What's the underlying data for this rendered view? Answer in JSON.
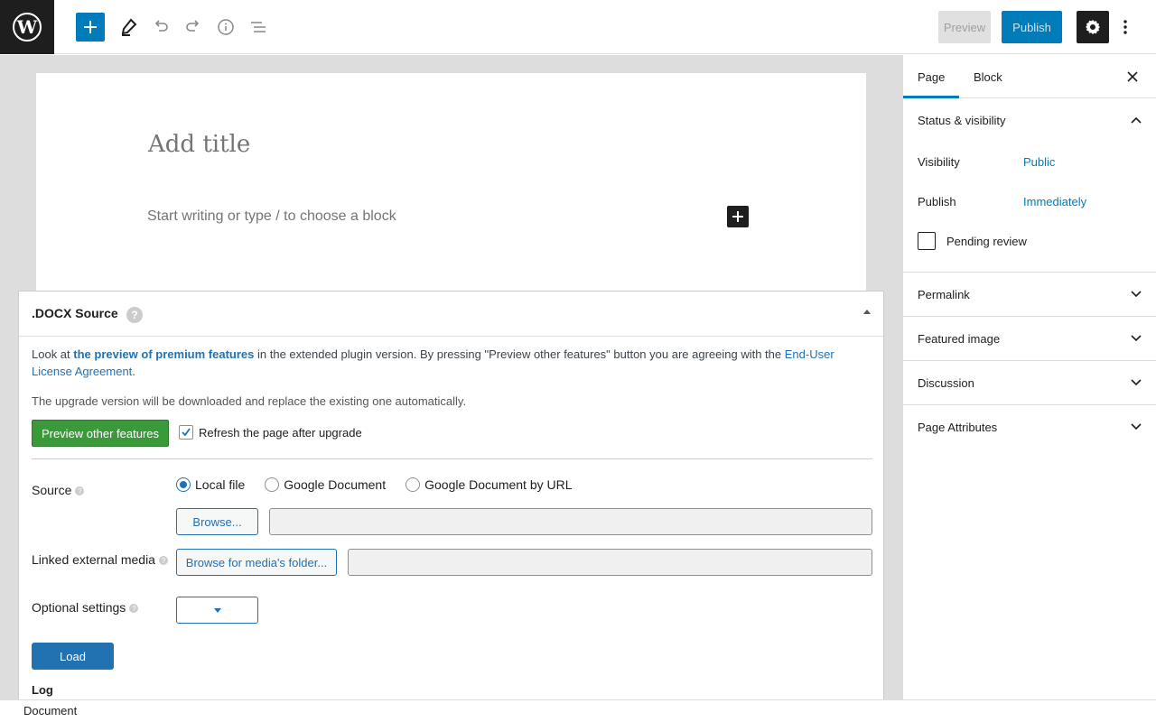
{
  "toolbar": {
    "logo_icon": "wordpress-logo",
    "add_icon": "plus-icon",
    "tools_icon": "pencil-icon",
    "undo_icon": "undo-icon",
    "redo_icon": "redo-icon",
    "info_icon": "info-icon",
    "list_view_icon": "list-view-icon",
    "preview_label": "Preview",
    "publish_label": "Publish",
    "settings_icon": "gear-icon",
    "more_icon": "kebab-menu-icon"
  },
  "editor": {
    "title_placeholder": "Add title",
    "block_placeholder": "Start writing or type / to choose a block"
  },
  "docx": {
    "title": ".DOCX Source",
    "intro_prefix": "Look at ",
    "intro_link": "the preview of premium features",
    "intro_middle": " in the extended plugin version. By pressing \"Preview other features\" button you are agreeing with the ",
    "eula_link": "End-User License Agreement",
    "intro_suffix": ".",
    "upgrade_note": "The upgrade version will be downloaded and replace the existing one automatically.",
    "preview_features_button": "Preview other features",
    "refresh_label": "Refresh the page after upgrade",
    "refresh_checked": true,
    "source_label": "Source",
    "source_options": [
      "Local file",
      "Google Document",
      "Google Document by URL"
    ],
    "source_selected": "Local file",
    "browse_button": "Browse...",
    "linked_media_label": "Linked external media",
    "browse_media_button": "Browse for media's folder...",
    "optional_label": "Optional settings",
    "load_button": "Load",
    "log_label": "Log"
  },
  "sidebar": {
    "tabs": [
      "Page",
      "Block"
    ],
    "active_tab": "Page",
    "status_title": "Status & visibility",
    "visibility_label": "Visibility",
    "visibility_value": "Public",
    "publish_label": "Publish",
    "publish_value": "Immediately",
    "pending_label": "Pending review",
    "panels": [
      "Permalink",
      "Featured image",
      "Discussion",
      "Page Attributes"
    ]
  },
  "footer": {
    "breadcrumb": "Document"
  },
  "colors": {
    "accent": "#007cba",
    "green": "#3a9a3a",
    "dark": "#1e1e1e"
  }
}
